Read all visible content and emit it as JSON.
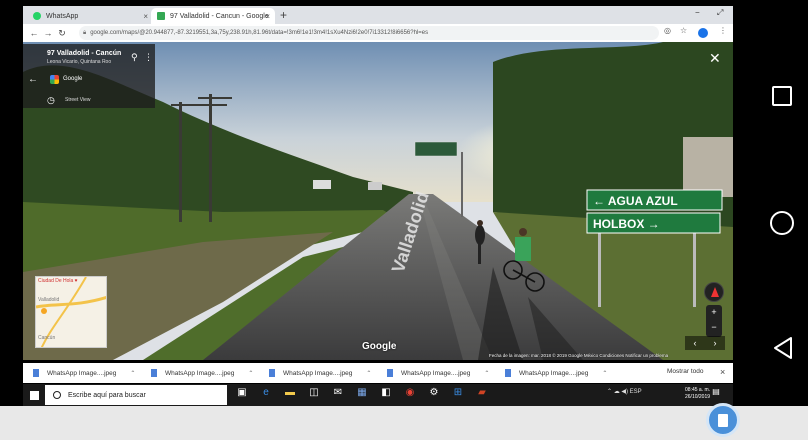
{
  "browser": {
    "tabs": [
      {
        "title": "WhatsApp",
        "active": false,
        "favicon_color": "#25d366"
      },
      {
        "title": "97 Valladolid - Cancun - Google",
        "active": true,
        "favicon_color": "#34a853"
      }
    ],
    "new_tab_label": "+",
    "window_controls": {
      "minimize": "−",
      "maximize": "⤢"
    },
    "url": "google.com/maps/@20.944877,-87.3219551,3a,75y,238.91h,81.96t/data=!3m6!1e1!3m4!1sXu4Nzi6!2e0!7i13312!8i6656?hl=es"
  },
  "streetview": {
    "location_title": "97 Valladolid - Cancún",
    "location_subtitle": "Leona Vicario, Quintana Roo",
    "provider": "Google",
    "mode_label": "Street View",
    "road_text": "Valladolid",
    "signs": [
      "← AGUA AZUL",
      "HOLBOX →"
    ],
    "watermark": "Google",
    "attribution": "Fecha de la imagen: mar. 2018   © 2019 Google   México   Condiciones   Notificar un problema",
    "minimap": {
      "title": "Ciudad De Hola ♥",
      "label_top": "Valladolid",
      "label_bottom": "Cancún"
    },
    "zoom_in": "+",
    "zoom_out": "−",
    "prev": "‹",
    "next": "›"
  },
  "downloads": {
    "items": [
      "WhatsApp Image....jpeg",
      "WhatsApp Image....jpeg",
      "WhatsApp Image....jpeg",
      "WhatsApp Image....jpeg",
      "WhatsApp Image....jpeg"
    ],
    "show_all": "Mostrar todo",
    "close": "×"
  },
  "taskbar": {
    "search_placeholder": "Escribe aquí para buscar",
    "tray_text": "⌃  ☁  ◀)  ESP",
    "time": "08:45 a. m.",
    "date": "26/10/2019"
  },
  "colors": {
    "accent": "#1a73e8",
    "sign_green": "#1f7a3e",
    "fab": "#4a90d9"
  }
}
